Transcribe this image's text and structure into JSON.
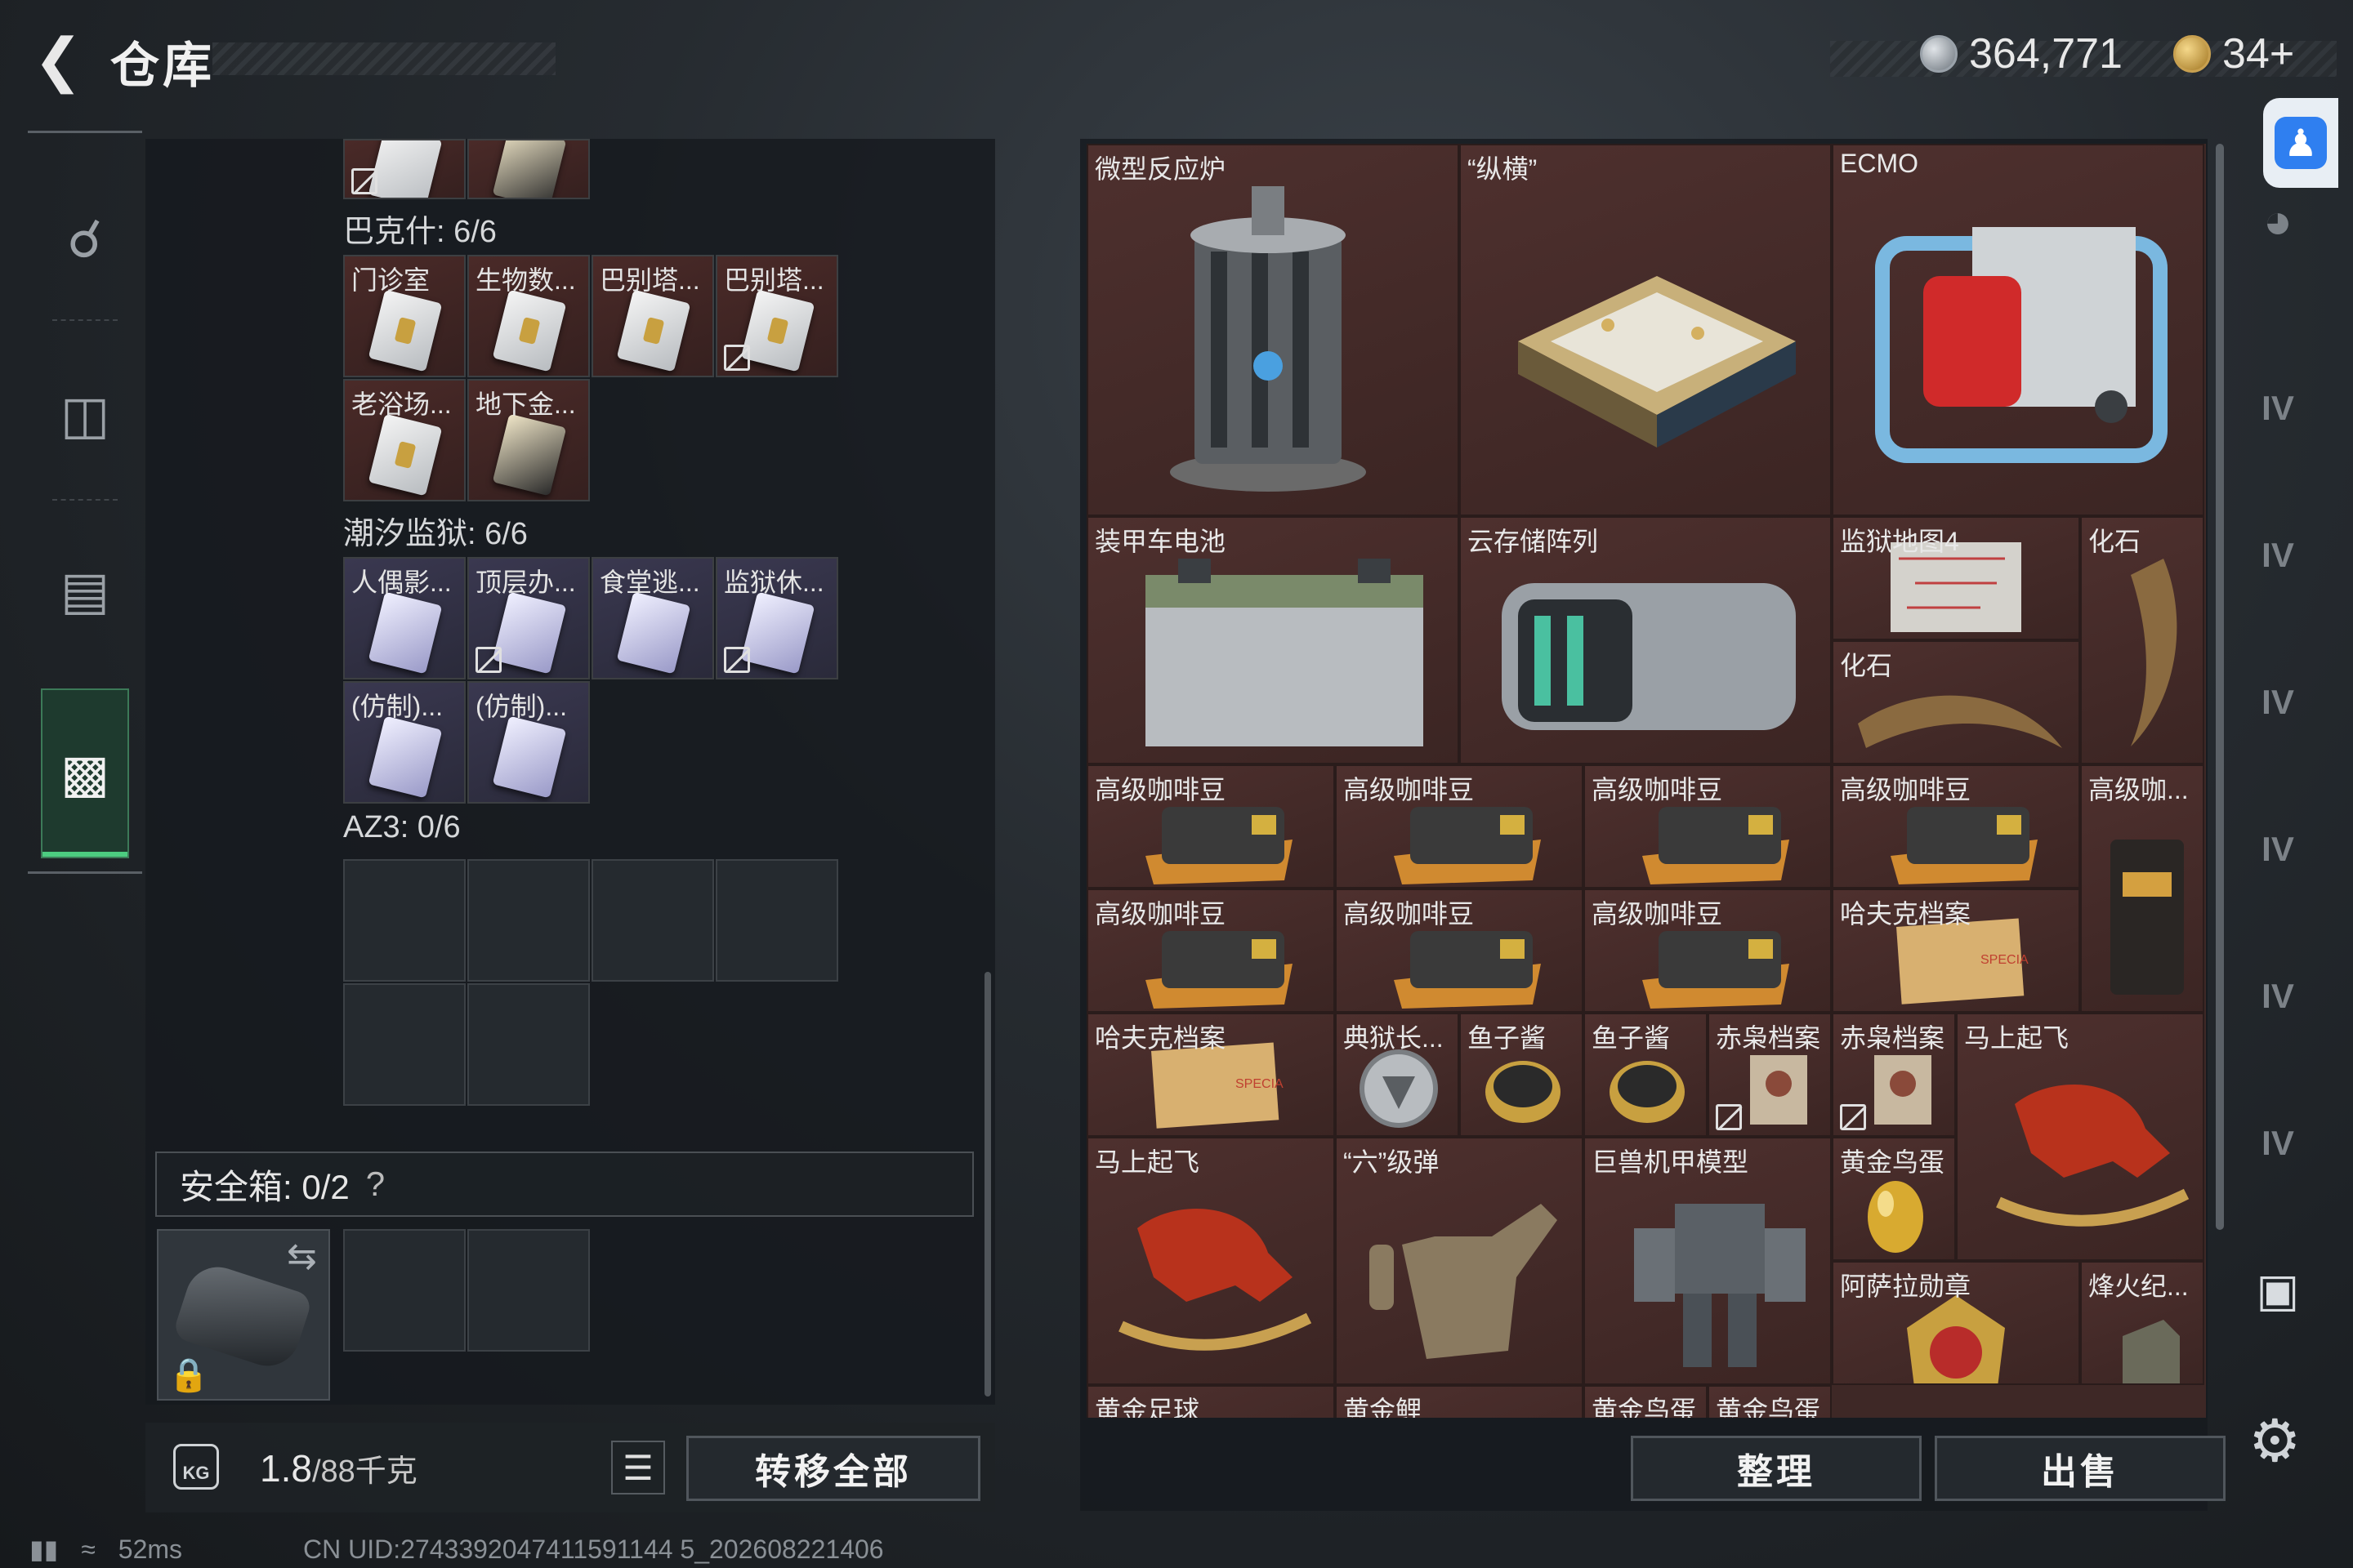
{
  "header": {
    "title": "仓库"
  },
  "currency": {
    "silver": "364,771",
    "gold": "34+"
  },
  "left": {
    "top_partial_labels": [
      "",
      ""
    ],
    "sections": [
      {
        "name": "巴克什: 6/6",
        "items": [
          "门诊室",
          "生物数...",
          "巴别塔...",
          "巴别塔...",
          "老浴场...",
          "地下金..."
        ]
      },
      {
        "name": "潮汐监狱: 6/6",
        "items": [
          "人偶影...",
          "顶层办...",
          "食堂逃...",
          "监狱休...",
          "(仿制)...",
          "(仿制)..."
        ]
      },
      {
        "name": "AZ3: 0/6",
        "items": []
      }
    ],
    "safebox": {
      "label": "安全箱: 0/2",
      "help": "?"
    },
    "bottom": {
      "weight": "1.8",
      "weight_unit": "/88千克",
      "bag_icon_text": "KG",
      "transfer_all": "转移全部"
    }
  },
  "right": {
    "items": [
      {
        "label": "微型反应炉"
      },
      {
        "label": "“纵横”"
      },
      {
        "label": "ECMO"
      },
      {
        "label": "装甲车电池"
      },
      {
        "label": "云存储阵列"
      },
      {
        "label": "监狱地图4"
      },
      {
        "label": "化石"
      },
      {
        "label": "化石"
      },
      {
        "label": "高级咖啡豆"
      },
      {
        "label": "高级咖啡豆"
      },
      {
        "label": "高级咖啡豆"
      },
      {
        "label": "高级咖啡豆"
      },
      {
        "label": "高级咖..."
      },
      {
        "label": "高级咖啡豆"
      },
      {
        "label": "高级咖啡豆"
      },
      {
        "label": "高级咖啡豆"
      },
      {
        "label": "哈夫克档案"
      },
      {
        "label": "哈夫克档案"
      },
      {
        "label": "典狱长..."
      },
      {
        "label": "鱼子酱"
      },
      {
        "label": "鱼子酱"
      },
      {
        "label": "赤枭档案"
      },
      {
        "label": "赤枭档案"
      },
      {
        "label": "马上起飞"
      },
      {
        "label": "马上起飞"
      },
      {
        "label": "“六”级弹"
      },
      {
        "label": "巨兽机甲模型"
      },
      {
        "label": "黄金鸟蛋"
      },
      {
        "label": "阿萨拉勋章"
      },
      {
        "label": "烽火纪..."
      },
      {
        "label": "黄金足球"
      },
      {
        "label": "黄金鲤"
      },
      {
        "label": "黄金鸟蛋"
      },
      {
        "label": "黄金鸟蛋"
      }
    ],
    "buttons": {
      "organize": "整理",
      "sell": "出售"
    }
  },
  "right_nav_labels": [
    "IV",
    "IV",
    "IV",
    "IV",
    "IV",
    "IV"
  ],
  "status": {
    "latency": "52ms",
    "uid": "CN UID:2743392047411591144 5_202608221406"
  },
  "colors": {
    "active_green": "#4ccc80",
    "item_bg": "#4e302e",
    "accent_blue": "#2f7ff0"
  }
}
